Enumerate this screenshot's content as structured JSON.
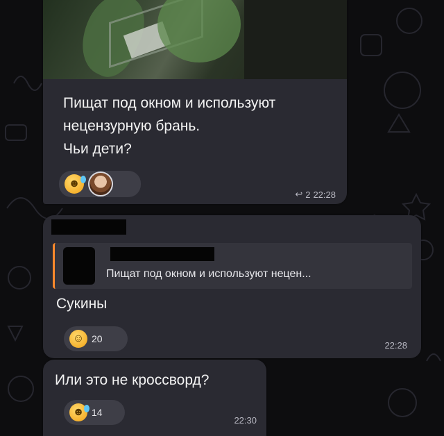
{
  "messages": [
    {
      "text_lines": [
        "Пищат под окном и используют",
        "нецензурную брань.",
        "Чьи дети?"
      ],
      "reactions": [
        {
          "emoji": "rolling-laughing"
        },
        {
          "emoji": "user-avatar"
        }
      ],
      "reply_count": "2",
      "time": "22:28"
    },
    {
      "quote_text": "Пищат под окном и используют нецен...",
      "text": "Сукины",
      "reaction_count": "20",
      "time": "22:28"
    },
    {
      "text": "Или это не кроссворд?",
      "reaction_count": "14",
      "time": "22:30"
    }
  ],
  "colors": {
    "background": "#0d0d0f",
    "bubble": "#2a2a32",
    "quote_accent": "#ff8a2b",
    "reaction_pill": "#3e3e47"
  }
}
